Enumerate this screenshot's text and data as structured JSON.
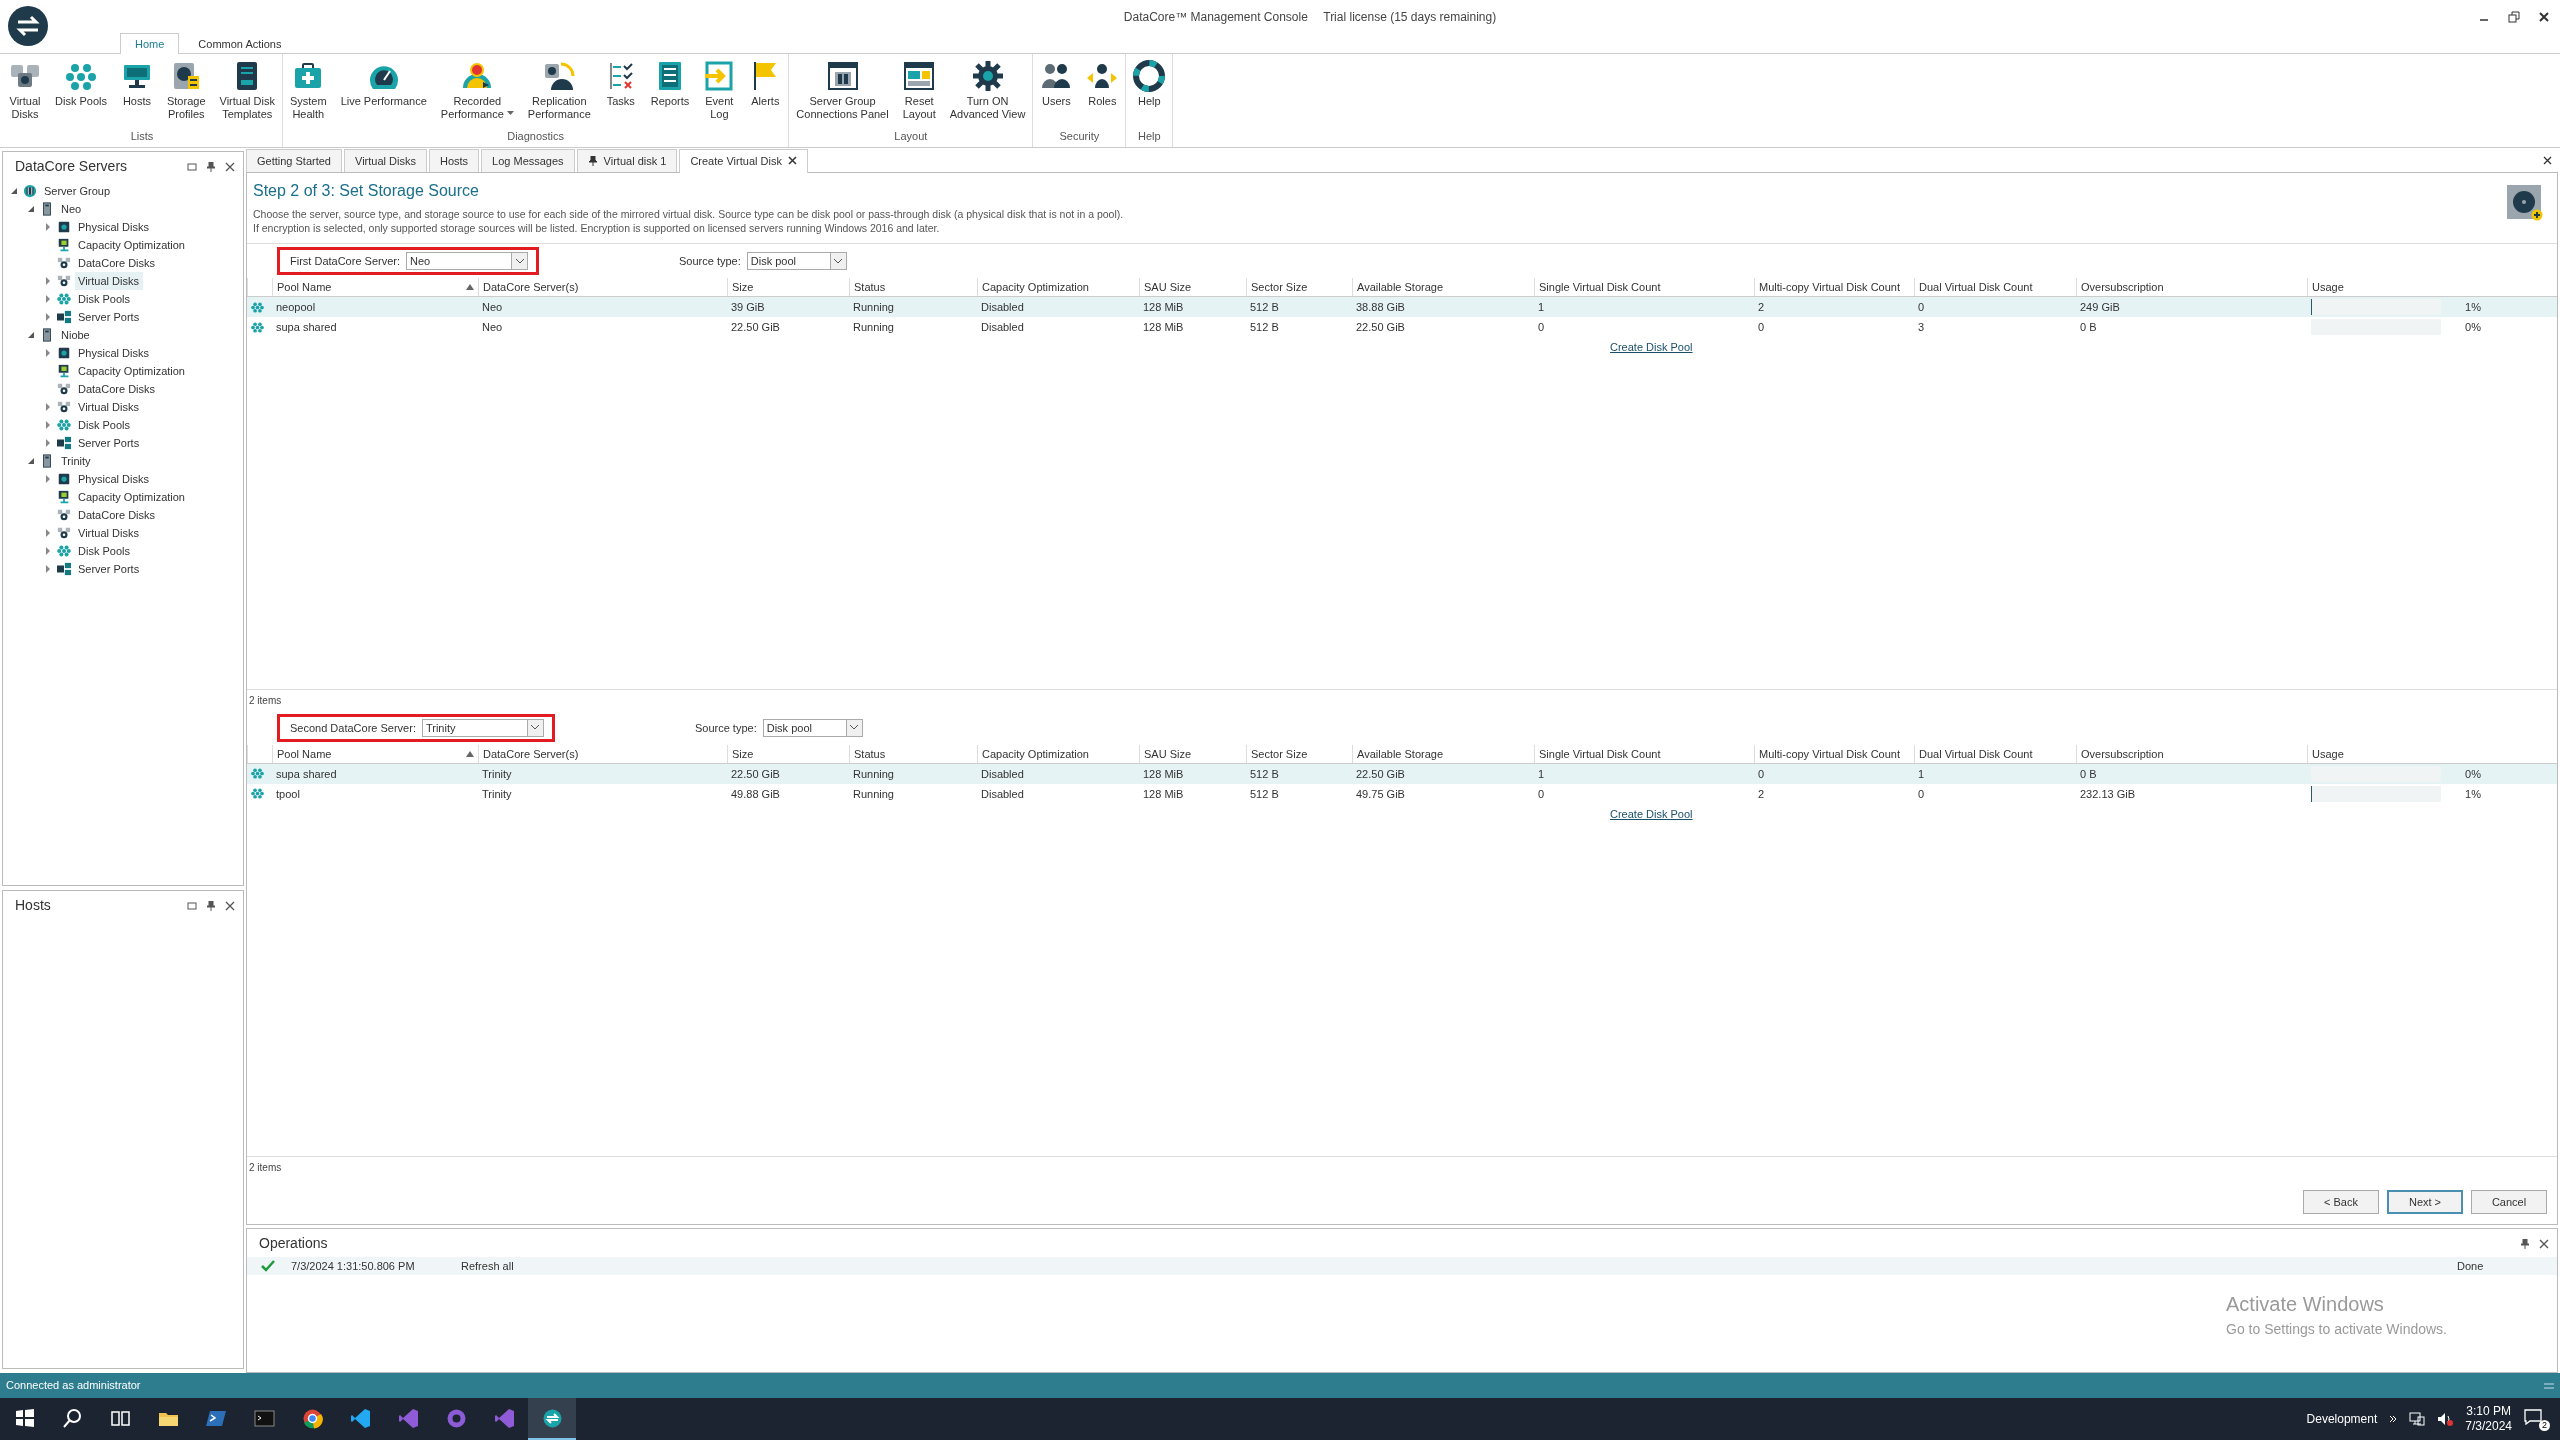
{
  "window": {
    "title": "DataCore™ Management Console",
    "license": "Trial license (15 days remaining)"
  },
  "ribbon": {
    "tabs": [
      {
        "label": "Home",
        "selected": true
      },
      {
        "label": "Common Actions",
        "selected": false
      }
    ],
    "groups": [
      {
        "label": "Lists",
        "buttons": [
          {
            "label": "Virtual\nDisks",
            "kind": "virtual-disks"
          },
          {
            "label": "Disk Pools",
            "kind": "disk-pools"
          },
          {
            "label": "Hosts",
            "kind": "hosts"
          },
          {
            "label": "Storage\nProfiles",
            "kind": "storage-profiles"
          },
          {
            "label": "Virtual Disk\nTemplates",
            "kind": "templates"
          }
        ]
      },
      {
        "label": "Diagnostics",
        "buttons": [
          {
            "label": "System\nHealth",
            "kind": "health"
          },
          {
            "label": "Live Performance",
            "kind": "live"
          },
          {
            "label": "Recorded\nPerformance",
            "kind": "recorded",
            "dropdown": true
          },
          {
            "label": "Replication\nPerformance",
            "kind": "replication"
          },
          {
            "label": "Tasks",
            "kind": "tasks"
          },
          {
            "label": "Reports",
            "kind": "reports"
          },
          {
            "label": "Event\nLog",
            "kind": "eventlog"
          },
          {
            "label": "Alerts",
            "kind": "alerts"
          }
        ]
      },
      {
        "label": "Layout",
        "buttons": [
          {
            "label": "Server Group\nConnections Panel",
            "kind": "sgpanel"
          },
          {
            "label": "Reset\nLayout",
            "kind": "reset"
          },
          {
            "label": "Turn ON\nAdvanced View",
            "kind": "advanced"
          }
        ]
      },
      {
        "label": "Security",
        "buttons": [
          {
            "label": "Users",
            "kind": "users"
          },
          {
            "label": "Roles",
            "kind": "roles"
          }
        ]
      },
      {
        "label": "Help",
        "buttons": [
          {
            "label": "Help",
            "kind": "help"
          }
        ]
      }
    ]
  },
  "servers_panel": {
    "title": "DataCore Servers",
    "tree": [
      {
        "label": "Server Group",
        "kind": "group",
        "expanded": true,
        "selected": false,
        "children": [
          {
            "label": "Neo",
            "kind": "server",
            "expanded": true,
            "selected": false,
            "children": [
              {
                "label": "Physical Disks",
                "kind": "physical",
                "expanded": false,
                "selected": false
              },
              {
                "label": "Capacity Optimization",
                "kind": "capacity",
                "selected": false
              },
              {
                "label": "DataCore Disks",
                "kind": "netdisk",
                "selected": false
              },
              {
                "label": "Virtual Disks",
                "kind": "netdisk",
                "expanded": false,
                "selected": true
              },
              {
                "label": "Disk Pools",
                "kind": "pool",
                "expanded": false,
                "selected": false
              },
              {
                "label": "Server Ports",
                "kind": "ports",
                "expanded": false,
                "selected": false
              }
            ]
          },
          {
            "label": "Niobe",
            "kind": "server",
            "expanded": true,
            "selected": false,
            "children": [
              {
                "label": "Physical Disks",
                "kind": "physical",
                "expanded": false,
                "selected": false
              },
              {
                "label": "Capacity Optimization",
                "kind": "capacity",
                "selected": false
              },
              {
                "label": "DataCore Disks",
                "kind": "netdisk",
                "selected": false
              },
              {
                "label": "Virtual Disks",
                "kind": "netdisk",
                "expanded": false,
                "selected": false
              },
              {
                "label": "Disk Pools",
                "kind": "pool",
                "expanded": false,
                "selected": false
              },
              {
                "label": "Server Ports",
                "kind": "ports",
                "expanded": false,
                "selected": false
              }
            ]
          },
          {
            "label": "Trinity",
            "kind": "server",
            "expanded": true,
            "selected": false,
            "children": [
              {
                "label": "Physical Disks",
                "kind": "physical",
                "expanded": false,
                "selected": false
              },
              {
                "label": "Capacity Optimization",
                "kind": "capacity",
                "selected": false
              },
              {
                "label": "DataCore Disks",
                "kind": "netdisk",
                "selected": false
              },
              {
                "label": "Virtual Disks",
                "kind": "netdisk",
                "expanded": false,
                "selected": false
              },
              {
                "label": "Disk Pools",
                "kind": "pool",
                "expanded": false,
                "selected": false
              },
              {
                "label": "Server Ports",
                "kind": "ports",
                "expanded": false,
                "selected": false
              }
            ]
          }
        ]
      }
    ]
  },
  "hosts_panel": {
    "title": "Hosts"
  },
  "doc_tabs": [
    {
      "label": "Getting Started",
      "selected": false
    },
    {
      "label": "Virtual Disks",
      "selected": false
    },
    {
      "label": "Hosts",
      "selected": false
    },
    {
      "label": "Log Messages",
      "selected": false
    },
    {
      "label": "Virtual disk 1",
      "selected": false,
      "pinned": true
    },
    {
      "label": "Create Virtual Disk",
      "selected": true,
      "closable": true
    }
  ],
  "wizard": {
    "title": "Step 2 of 3: Set Storage Source",
    "description": [
      "Choose the server, source type, and storage source to use for each side of the mirrored virtual disk. Source type can be disk pool or pass-through disk (a physical disk that is not in a pool).",
      "If encryption is selected, only supported storage sources will be listed.  Encryption is supported on licensed servers running Windows 2016 and later."
    ],
    "sections": [
      {
        "server_label": "First DataCore Server:",
        "server_value": "Neo",
        "source_label": "Source type:",
        "source_value": "Disk pool",
        "columns": [
          {
            "label": "Pool Name",
            "sorted": true
          },
          {
            "label": "DataCore Server(s)"
          },
          {
            "label": "Size"
          },
          {
            "label": "Status"
          },
          {
            "label": "Capacity Optimization"
          },
          {
            "label": "SAU Size"
          },
          {
            "label": "Sector Size"
          },
          {
            "label": "Available Storage"
          },
          {
            "label": "Single Virtual Disk Count"
          },
          {
            "label": "Multi-copy Virtual Disk Count"
          },
          {
            "label": "Dual Virtual Disk Count"
          },
          {
            "label": "Oversubscription"
          },
          {
            "label": "Usage"
          }
        ],
        "rows": [
          {
            "selected": true,
            "cells": [
              "neopool",
              "Neo",
              "39 GiB",
              "Running",
              "Disabled",
              "128 MiB",
              "512 B",
              "38.88 GiB",
              "1",
              "2",
              "0",
              "249 GiB"
            ],
            "usage": {
              "level": 0.01,
              "reading": "1%"
            }
          },
          {
            "selected": false,
            "cells": [
              "supa shared",
              "Neo",
              "22.50 GiB",
              "Running",
              "Disabled",
              "128 MiB",
              "512 B",
              "22.50 GiB",
              "0",
              "0",
              "3",
              "0 B"
            ],
            "usage": {
              "level": 0,
              "reading": "0%"
            }
          }
        ],
        "link": "Create Disk Pool",
        "footer": "2 items"
      },
      {
        "server_label": "Second DataCore Server:",
        "server_value": "Trinity",
        "source_label": "Source type:",
        "source_value": "Disk pool",
        "columns": [
          {
            "label": "Pool Name",
            "sorted": true
          },
          {
            "label": "DataCore Server(s)"
          },
          {
            "label": "Size"
          },
          {
            "label": "Status"
          },
          {
            "label": "Capacity Optimization"
          },
          {
            "label": "SAU Size"
          },
          {
            "label": "Sector Size"
          },
          {
            "label": "Available Storage"
          },
          {
            "label": "Single Virtual Disk Count"
          },
          {
            "label": "Multi-copy Virtual Disk Count"
          },
          {
            "label": "Dual Virtual Disk Count"
          },
          {
            "label": "Oversubscription"
          },
          {
            "label": "Usage"
          }
        ],
        "rows": [
          {
            "selected": true,
            "cells": [
              "supa shared",
              "Trinity",
              "22.50 GiB",
              "Running",
              "Disabled",
              "128 MiB",
              "512 B",
              "22.50 GiB",
              "1",
              "0",
              "1",
              "0 B"
            ],
            "usage": {
              "level": 0,
              "reading": "0%"
            }
          },
          {
            "selected": false,
            "cells": [
              "tpool",
              "Trinity",
              "49.88 GiB",
              "Running",
              "Disabled",
              "128 MiB",
              "512 B",
              "49.75 GiB",
              "0",
              "2",
              "0",
              "232.13 GiB"
            ],
            "usage": {
              "level": 0.01,
              "reading": "1%"
            }
          }
        ],
        "link": "Create Disk Pool",
        "footer": "2 items"
      }
    ],
    "buttons": [
      {
        "label": "< Back",
        "default": false
      },
      {
        "label": "Next >",
        "default": true
      },
      {
        "label": "Cancel",
        "default": false
      }
    ]
  },
  "operations": {
    "title": "Operations",
    "rows": [
      {
        "ok": true,
        "time": "7/3/2024 1:31:50.806 PM",
        "action": "Refresh all",
        "status": "Done"
      }
    ]
  },
  "activation": {
    "title": "Activate Windows",
    "subtitle": "Go to Settings to activate Windows."
  },
  "status_bar": "Connected as administrator",
  "taskbar": {
    "apps": [
      {
        "kind": "start",
        "selected": false
      },
      {
        "kind": "search",
        "selected": false
      },
      {
        "kind": "taskview",
        "selected": false
      },
      {
        "kind": "explorer",
        "selected": false
      },
      {
        "kind": "shell",
        "selected": false
      },
      {
        "kind": "terminal",
        "selected": false
      },
      {
        "kind": "browser",
        "selected": false
      },
      {
        "kind": "code",
        "selected": false
      },
      {
        "kind": "ide",
        "selected": false
      },
      {
        "kind": "purple",
        "selected": false
      },
      {
        "kind": "ide",
        "selected": false
      },
      {
        "kind": "datacore",
        "selected": true
      }
    ],
    "label": "Development",
    "time": "3:10 PM",
    "date": "7/3/2024",
    "notifications": "2"
  }
}
